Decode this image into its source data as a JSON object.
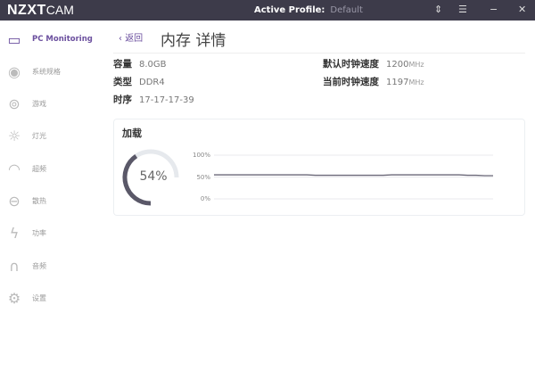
{
  "titlebar": {
    "logo": "NZXT",
    "logo_suffix": "CAM",
    "profile_label": "Active Profile:",
    "profile_value": "Default"
  },
  "sidebar": {
    "items": [
      {
        "label": "PC Monitoring",
        "icon": "monitor-icon",
        "active": true
      },
      {
        "label": "系统规格",
        "icon": "eye-icon"
      },
      {
        "label": "游戏",
        "icon": "gamepad-icon"
      },
      {
        "label": "灯光",
        "icon": "light-icon"
      },
      {
        "label": "超频",
        "icon": "gauge-icon"
      },
      {
        "label": "散热",
        "icon": "cooling-icon"
      },
      {
        "label": "功率",
        "icon": "power-icon"
      },
      {
        "label": "音频",
        "icon": "headset-icon"
      },
      {
        "label": "设置",
        "icon": "gear-icon"
      }
    ]
  },
  "header": {
    "back": "返回",
    "title": "内存 详情"
  },
  "specs": {
    "capacity": {
      "k": "容量",
      "v": "8.0GB"
    },
    "type": {
      "k": "类型",
      "v": "DDR4"
    },
    "timing": {
      "k": "时序",
      "v": "17-17-17-39"
    },
    "default_clock": {
      "k": "默认时钟速度",
      "v": "1200",
      "u": "MHz"
    },
    "current_clock": {
      "k": "当前时钟速度",
      "v": "1197",
      "u": "MHz"
    }
  },
  "load": {
    "title": "加载",
    "value": 54,
    "value_label": "54%",
    "accent": "#5a5868"
  },
  "chart_data": {
    "type": "line",
    "yticks": [
      "100%",
      "50%",
      "0%"
    ],
    "ylim": [
      0,
      100
    ],
    "grid": true,
    "values": [
      55,
      55,
      55,
      55,
      55,
      55,
      55,
      55,
      55,
      55,
      55,
      55,
      54,
      54,
      54,
      54,
      54,
      54,
      54,
      54,
      54,
      55,
      55,
      55,
      55,
      55,
      55,
      55,
      55,
      55,
      54,
      54,
      53,
      53
    ]
  }
}
